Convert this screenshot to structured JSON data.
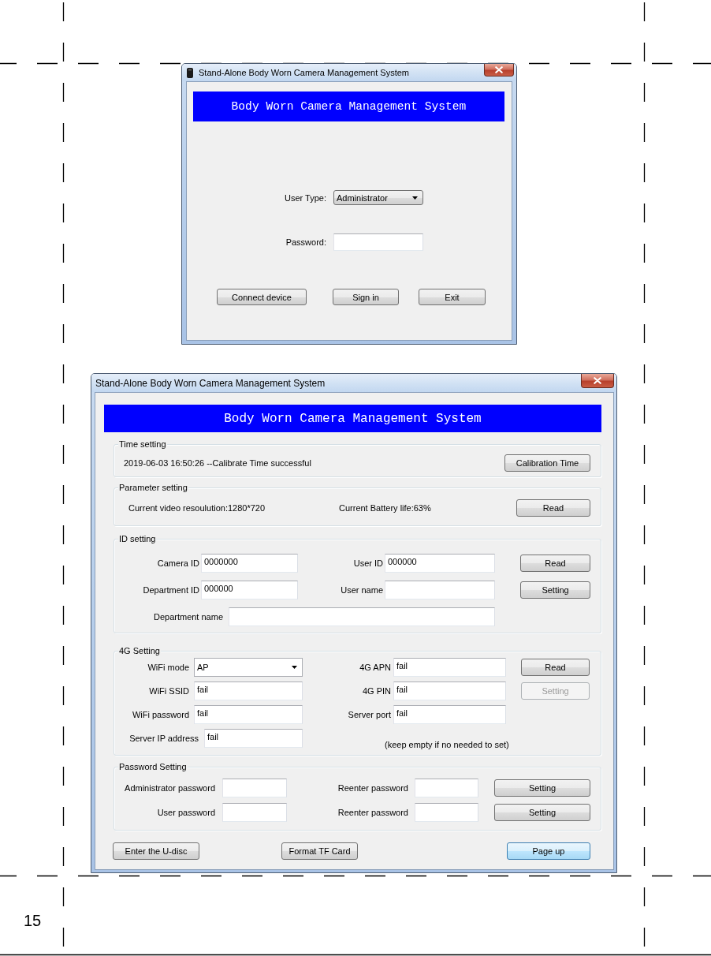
{
  "login_window": {
    "title": "Stand-Alone Body Worn Camera Management System",
    "banner": "Body Worn Camera Management System",
    "user_type": {
      "label": "User Type:",
      "value": "Administrator"
    },
    "password": {
      "label": "Password:"
    },
    "buttons": [
      "Connect device",
      "Sign in",
      "Exit"
    ]
  },
  "settings_window": {
    "title": "Stand-Alone Body Worn Camera Management System",
    "banner": "Body Worn Camera Management System",
    "time_setting": {
      "title": "Time setting",
      "status": "2019-06-03 16:50:26 --Calibrate Time successful",
      "button": "Calibration Time"
    },
    "parameter_setting": {
      "title": "Parameter setting",
      "resolution": "Current video resoulution:1280*720",
      "battery": "Current Battery life:63%",
      "button": "Read"
    },
    "id_setting": {
      "title": "ID setting",
      "fields": [
        {
          "label": "Camera ID",
          "value": "0000000"
        },
        {
          "label": "User ID",
          "value": "000000"
        },
        {
          "label": "Department ID",
          "value": "000000"
        },
        {
          "label": "User name"
        },
        {
          "label": "Department name"
        }
      ],
      "buttons": [
        "Read",
        "Setting"
      ]
    },
    "4g_setting": {
      "title": "4G Setting",
      "fields": [
        {
          "kind": "dropdown",
          "label": "WiFi mode",
          "value": "AP"
        },
        {
          "kind": "text",
          "label": "4G APN",
          "value": "fail"
        },
        {
          "kind": "text",
          "label": "WiFi SSID",
          "value": "fail"
        },
        {
          "kind": "text",
          "label": "4G PIN",
          "value": "fail"
        },
        {
          "kind": "text",
          "label": "WiFi password",
          "value": "fail"
        },
        {
          "kind": "text",
          "label": "Server port",
          "value": "fail"
        },
        {
          "kind": "text",
          "label": "Server IP address",
          "value": "fail"
        }
      ],
      "note": "(keep empty if no needed to set)",
      "buttons": [
        {
          "label": "Read",
          "disabled": false
        },
        {
          "label": "Setting",
          "disabled": true
        }
      ]
    },
    "password_setting": {
      "title": "Password Setting",
      "fields": [
        {
          "label": "Administrator password"
        },
        {
          "label": "Reenter password"
        },
        {
          "label": "User password"
        },
        {
          "label": "Reenter password"
        }
      ],
      "buttons": [
        "Setting",
        "Setting"
      ]
    },
    "footer_buttons": [
      {
        "label": "Enter the U-disc",
        "focused": false
      },
      {
        "label": "Format TF Card",
        "focused": false
      },
      {
        "label": "Page up",
        "focused": true
      }
    ]
  },
  "page_number": "15"
}
